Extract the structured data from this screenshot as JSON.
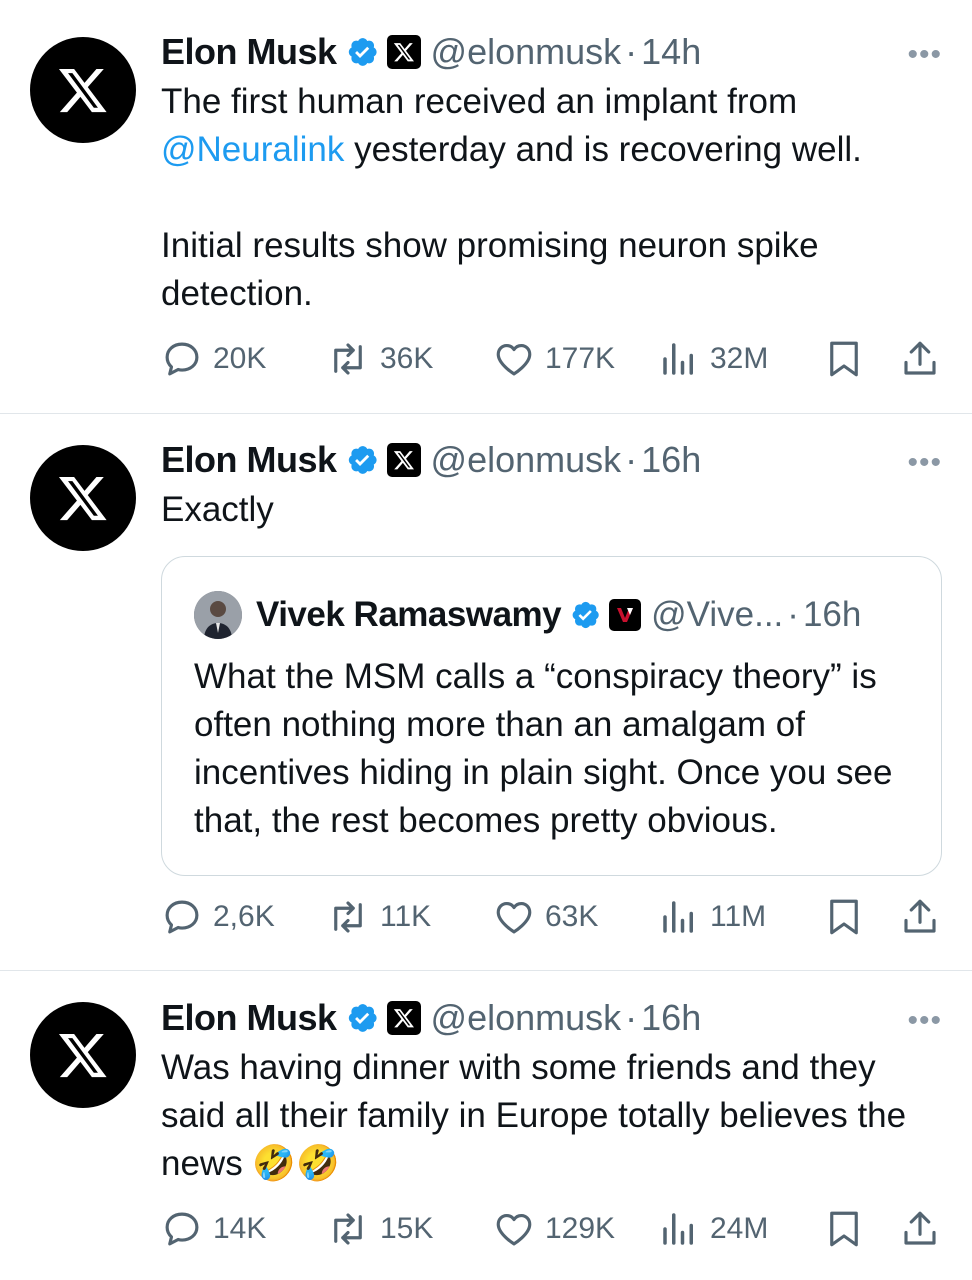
{
  "tweets": [
    {
      "name": "Elon Musk",
      "handle": "@elonmusk",
      "sep": "·",
      "time": "14h",
      "more": "•••",
      "text_parts": {
        "line1": "The first human received an implant from",
        "mention": "@Neuralink",
        "line2_rest": " yesterday and is recovering well.",
        "para2": "Initial results show promising neuron spike detection."
      },
      "replies": "20K",
      "reposts": "36K",
      "likes": "177K",
      "views": "32M"
    },
    {
      "name": "Elon Musk",
      "handle": "@elonmusk",
      "sep": "·",
      "time": "16h",
      "more": "•••",
      "text": "Exactly",
      "quote": {
        "name": "Vivek Ramaswamy",
        "handle": "@Vive...",
        "sep": "·",
        "time": "16h",
        "text": "What the MSM calls a “conspiracy theory” is often nothing more than an amalgam of incentives hiding in plain sight. Once you see that, the rest becomes pretty obvious."
      },
      "replies": "2,6K",
      "reposts": "11K",
      "likes": "63K",
      "views": "11M"
    },
    {
      "name": "Elon Musk",
      "handle": "@elonmusk",
      "sep": "·",
      "time": "16h",
      "more": "•••",
      "text": "Was having dinner with some friends and they said all their family in Europe totally believes the news 🤣🤣",
      "replies": "14K",
      "reposts": "15K",
      "likes": "129K",
      "views": "24M"
    }
  ],
  "colors": {
    "link": "#1d9bf0",
    "verified": "#1d9bf0",
    "muted": "#536471"
  },
  "icons": [
    "x-logo-icon",
    "verified-badge-icon",
    "reply-icon",
    "repost-icon",
    "like-icon",
    "views-icon",
    "bookmark-icon",
    "share-icon",
    "more-icon"
  ]
}
